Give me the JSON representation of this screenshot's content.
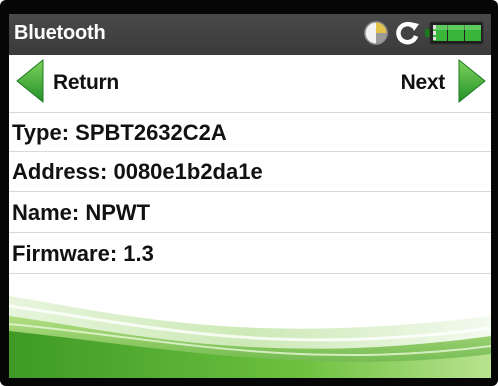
{
  "window": {
    "title": "Bluetooth"
  },
  "status_bar": {
    "icons": [
      "pie-timer-icon",
      "refresh-icon",
      "battery-icon"
    ],
    "accent": "#2aa82a"
  },
  "nav": {
    "return_label": "Return",
    "next_label": "Next",
    "arrow_color": "#2f9e2f"
  },
  "device": {
    "type": "Type: SPBT2632C2A",
    "address": "Address: 0080e1b2da1e",
    "name": "Name: NPWT",
    "firmware": "Firmware: 1.3"
  },
  "theme": {
    "titlebar_color": "#3f3f3f",
    "wave_color": "#5fb82a"
  }
}
